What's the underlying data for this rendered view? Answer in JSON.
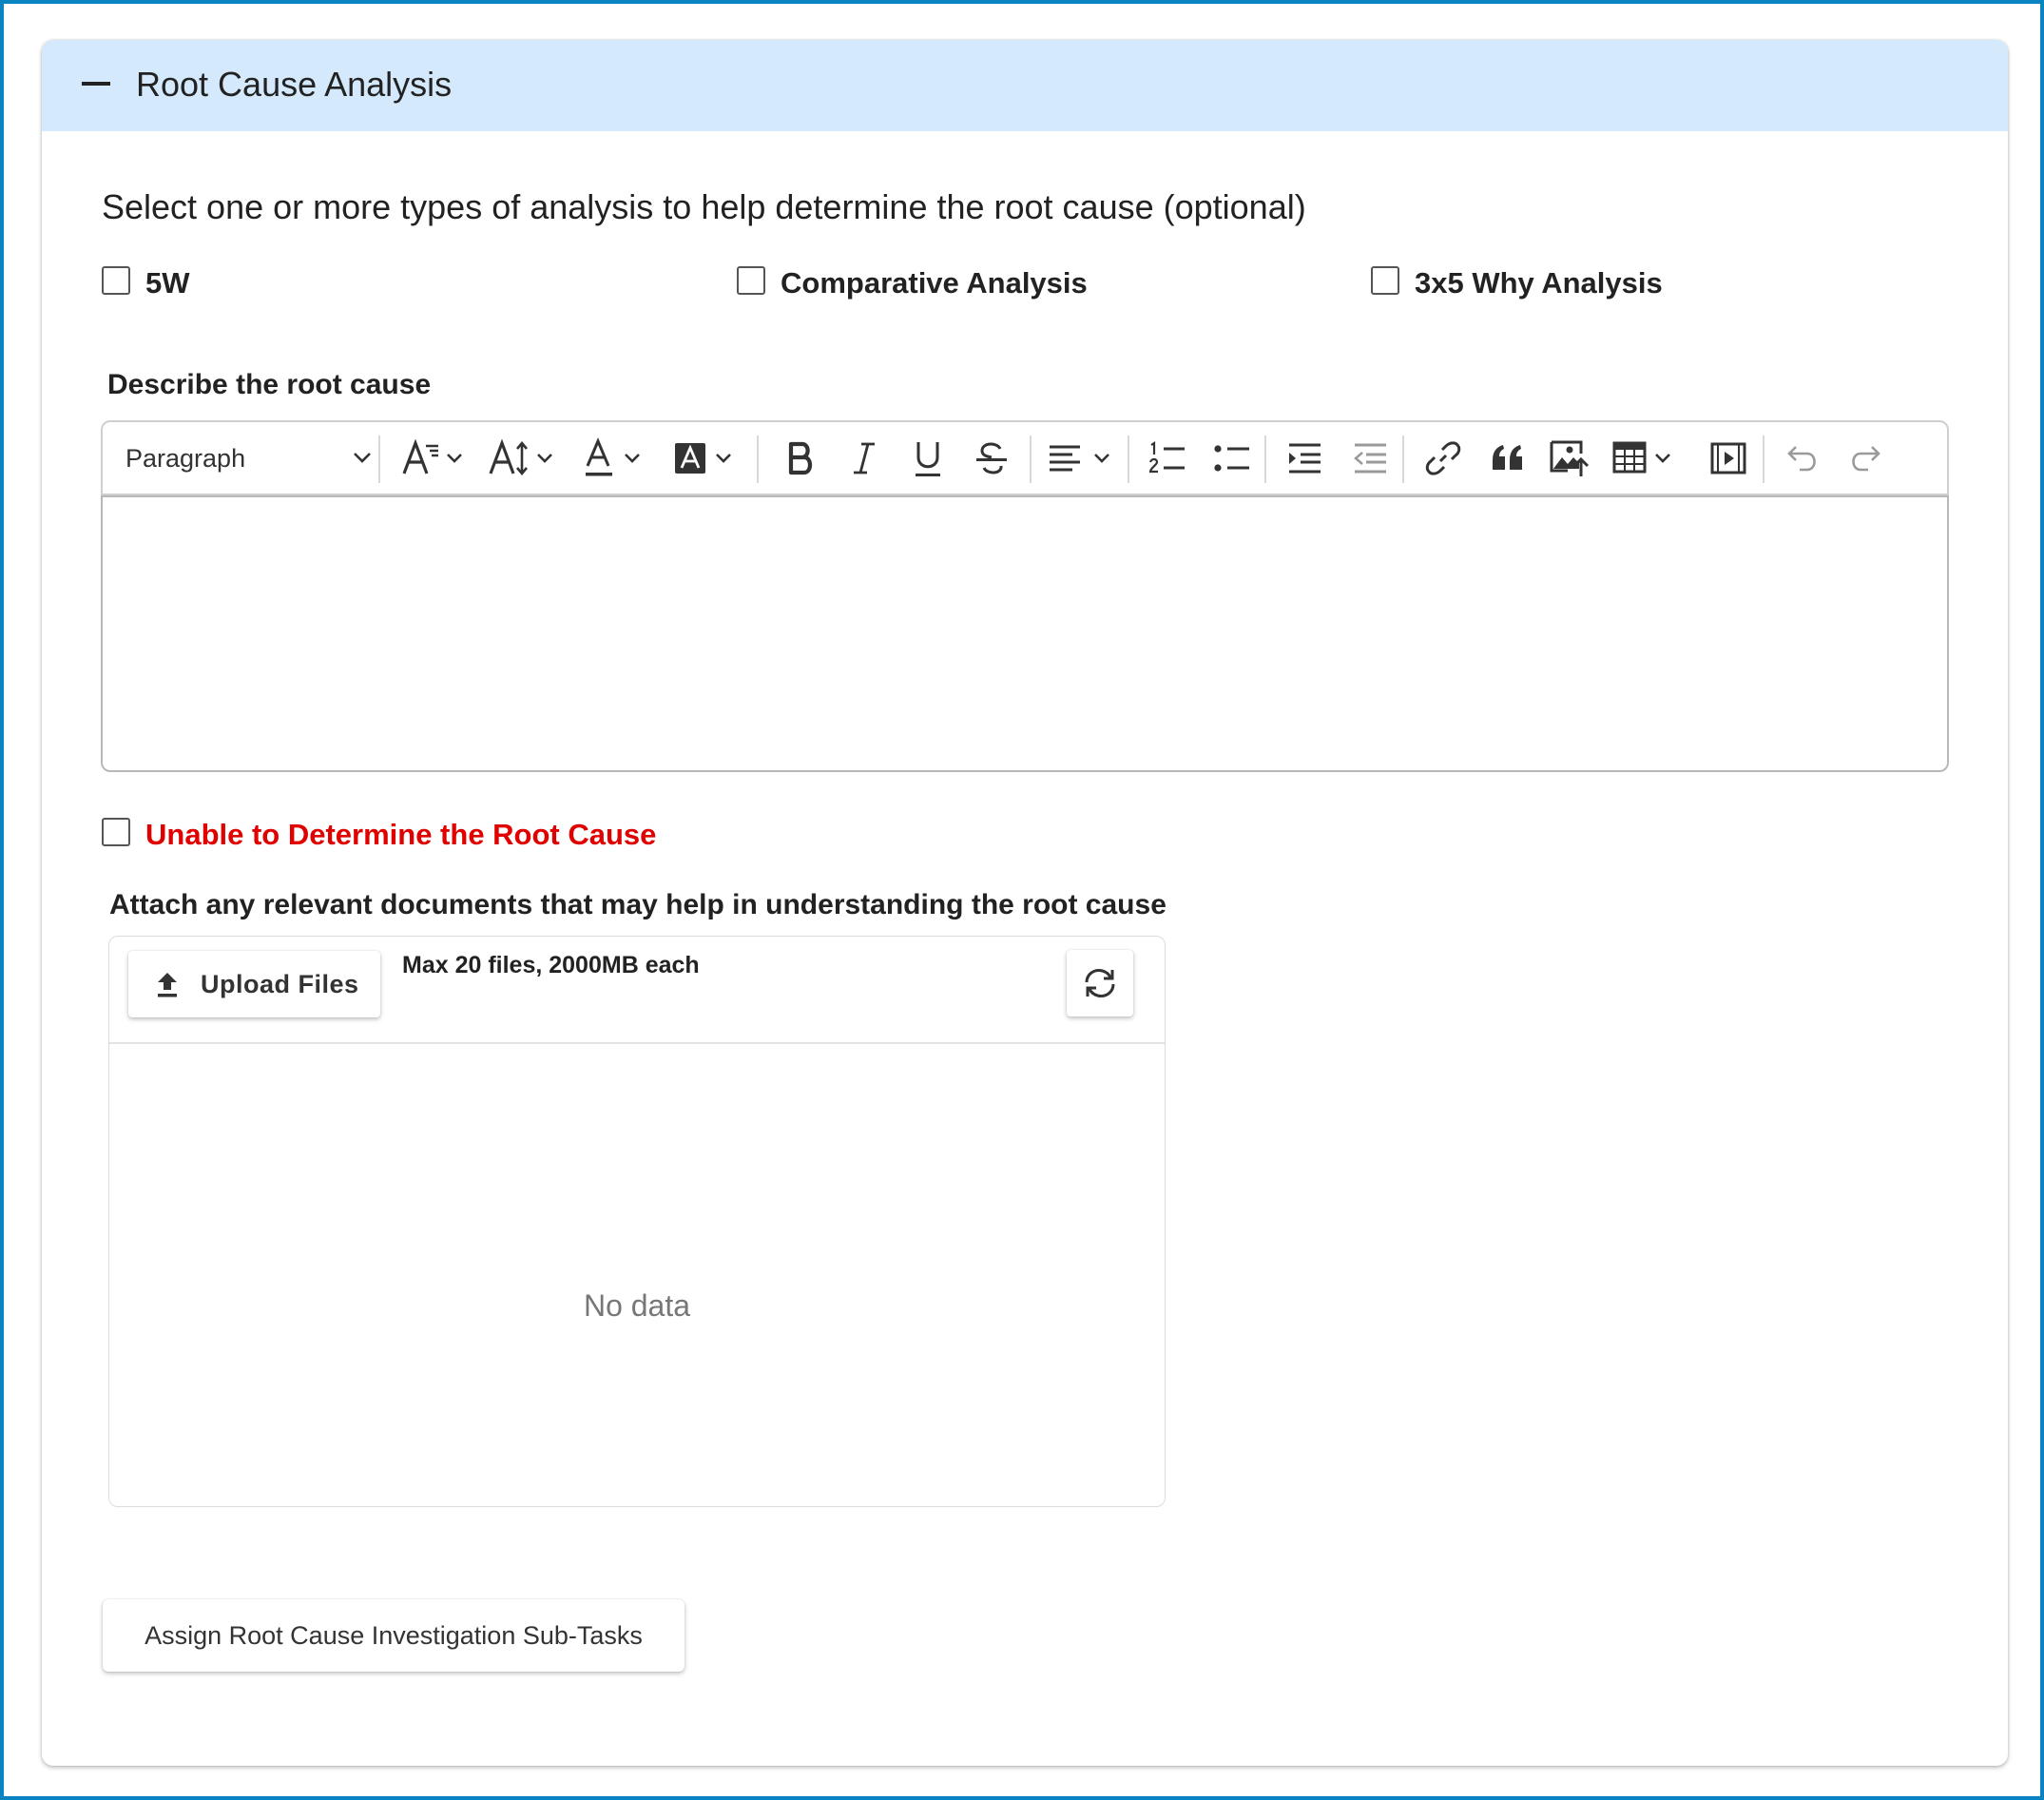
{
  "panel": {
    "title": "Root Cause Analysis"
  },
  "analysis": {
    "heading": "Select one or more types of analysis to help determine the root cause (optional)",
    "options": [
      {
        "label": "5W",
        "checked": false
      },
      {
        "label": "Comparative Analysis",
        "checked": false
      },
      {
        "label": "3x5 Why Analysis",
        "checked": false
      }
    ]
  },
  "describe": {
    "label": "Describe the root cause",
    "editor": {
      "paragraph_label": "Paragraph",
      "content": "",
      "tools": [
        "font-size",
        "line-height",
        "font-color",
        "background-color",
        "bold",
        "italic",
        "underline",
        "strikethrough",
        "align",
        "numbered-list",
        "bulleted-list",
        "indent",
        "outdent",
        "link",
        "blockquote",
        "insert-image",
        "insert-table",
        "media-embed",
        "undo",
        "redo"
      ]
    }
  },
  "unable": {
    "label": "Unable to Determine the Root Cause",
    "checked": false,
    "color": "#e00000"
  },
  "attachments": {
    "label": "Attach any relevant documents that may help in understanding the root cause",
    "upload_label": "Upload Files",
    "limit_text": "Max 20 files, 2000MB each",
    "empty_text": "No data"
  },
  "assign": {
    "label": "Assign Root Cause Investigation Sub-Tasks"
  },
  "colors": {
    "frame_border": "#0a84c1",
    "header_bg": "#d4eafc"
  }
}
